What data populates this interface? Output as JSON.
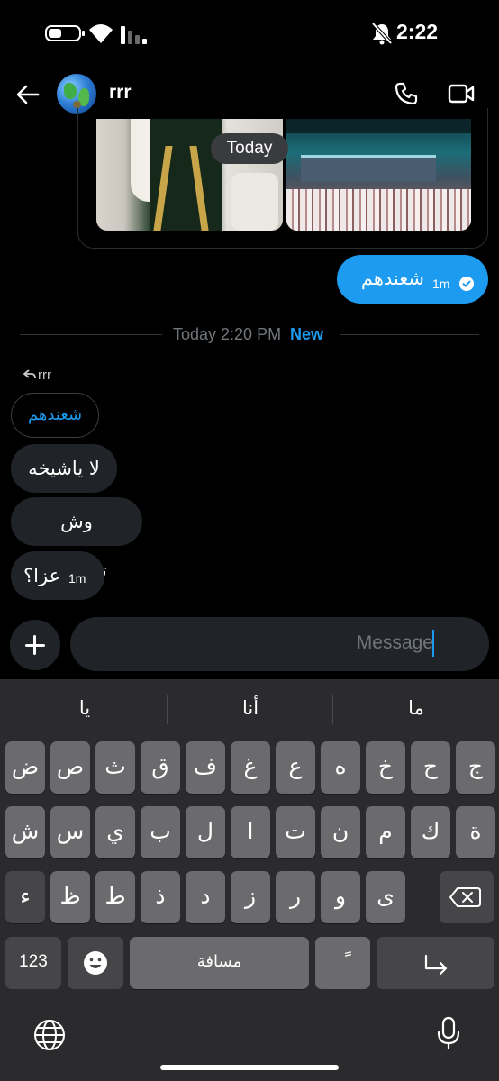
{
  "status_bar": {
    "time": "2:22",
    "icons": [
      "battery-icon",
      "wifi-icon",
      "signal-icon",
      "bell-muted-icon"
    ]
  },
  "header": {
    "contact_name": "rrr",
    "icons": [
      "back-arrow-icon",
      "avatar-globe",
      "phone-icon",
      "video-icon"
    ]
  },
  "image_message": {
    "date_chip": "Today"
  },
  "sent_message": {
    "text": "شعندهم",
    "time": "1m",
    "status_icon": "sent-check-icon"
  },
  "divider": {
    "text": "Today 2:20 PM",
    "new_label": "New"
  },
  "received": {
    "reply_to": "rrr",
    "quoted": "شعندهم",
    "messages": [
      {
        "text": "لا ياشيخه"
      },
      {
        "text": "وش تشوفين"
      },
      {
        "text": "عزا؟",
        "time": "1m"
      }
    ]
  },
  "composer": {
    "placeholder": "Message",
    "add_icon": "plus-icon"
  },
  "keyboard": {
    "suggestions": [
      "يا",
      "أنا",
      "ما"
    ],
    "row1": [
      "ض",
      "ص",
      "ث",
      "ق",
      "ف",
      "غ",
      "ع",
      "ه",
      "خ",
      "ح",
      "ج"
    ],
    "row2": [
      "ش",
      "س",
      "ي",
      "ب",
      "ل",
      "ا",
      "ت",
      "ن",
      "م",
      "ك",
      "ة"
    ],
    "row3": [
      "ء",
      "ظ",
      "ط",
      "ذ",
      "د",
      "ز",
      "ر",
      "و",
      "ى"
    ],
    "numbers_label": "123",
    "space_label": "مسافة",
    "diacritic_label": "ً",
    "icons": [
      "emoji-icon",
      "return-icon",
      "delete-icon",
      "globe-icon",
      "microphone-icon"
    ]
  }
}
